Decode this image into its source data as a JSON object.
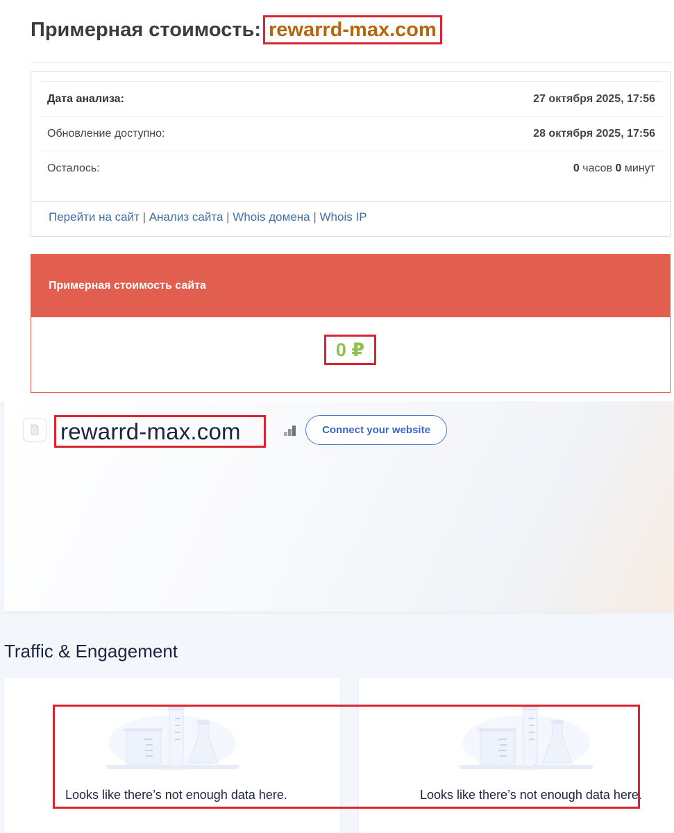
{
  "header": {
    "title_prefix": "Примерная стоимость:",
    "domain": "rewarrd-max.com"
  },
  "info": {
    "rows": [
      {
        "label": "Дата анализа:",
        "value": "27 октября 2025, 17:56"
      },
      {
        "label": "Обновление доступно:",
        "value": "28 октября 2025, 17:56"
      }
    ],
    "remaining": {
      "label": "Осталось:",
      "hours_value": "0",
      "hours_unit": "часов",
      "minutes_value": "0",
      "minutes_unit": "минут"
    },
    "links": {
      "goto_site": "Перейти на сайт",
      "site_analysis": "Анализ сайта",
      "whois_domain": "Whois домена",
      "whois_ip": "Whois IP",
      "separator": "|"
    }
  },
  "cost_card": {
    "title": "Примерная стоимость сайта",
    "value": "0 ₽"
  },
  "site_header": {
    "domain": "rewarrd-max.com",
    "favicon_icon": "document-icon",
    "rank_icon": "bar-chart-icon",
    "connect_button": "Connect your website"
  },
  "traffic": {
    "section_title": "Traffic & Engagement",
    "cards": [
      {
        "illustration": "lab-flasks-illustration",
        "message": "Looks like there’s not enough data here."
      },
      {
        "illustration": "lab-flasks-illustration",
        "message": "Looks like there’s not enough data here."
      }
    ]
  },
  "colors": {
    "accent_red": "#e25f50",
    "highlight_border": "#d9232e",
    "domain_orange": "#b6670c",
    "value_green": "#8cc152",
    "link_blue": "#3f6fa6",
    "button_blue": "#3a67c6",
    "navy_text": "#1b2540"
  }
}
